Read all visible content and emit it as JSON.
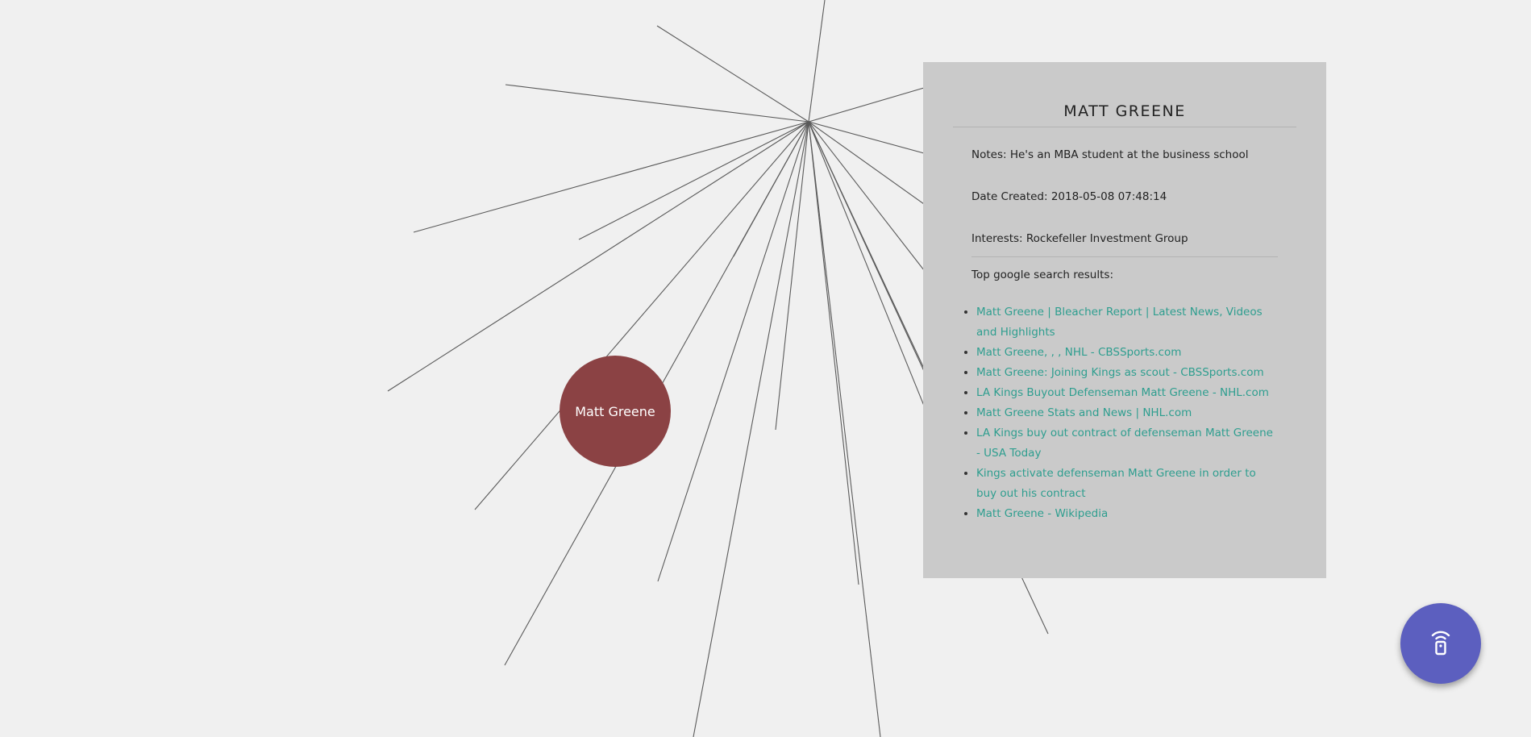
{
  "node": {
    "label": "Matt Greene",
    "color": "#8b4244"
  },
  "panel": {
    "title": "MATT GREENE",
    "notes": "Notes: He's an MBA student at the business school",
    "date_created": "Date Created: 2018-05-08 07:48:14",
    "interests": "Interests: Rockefeller Investment Group",
    "top_results_heading": "Top google search results:",
    "results": [
      "Matt Greene | Bleacher Report | Latest News, Videos and Highlights",
      "Matt Greene, , , NHL - CBSSports.com",
      "Matt Greene: Joining Kings as scout - CBSSports.com",
      "LA Kings Buyout Defenseman Matt Greene - NHL.com",
      "Matt Greene Stats and News | NHL.com",
      "LA Kings buy out contract of defenseman Matt Greene - USA Today",
      "Kings activate defenseman Matt Greene in order to buy out his contract",
      "Matt Greene - Wikipedia"
    ],
    "link_color": "#2e9e8f"
  },
  "fab": {
    "icon": "wireless-remote-icon",
    "color": "#5c5fbf"
  }
}
